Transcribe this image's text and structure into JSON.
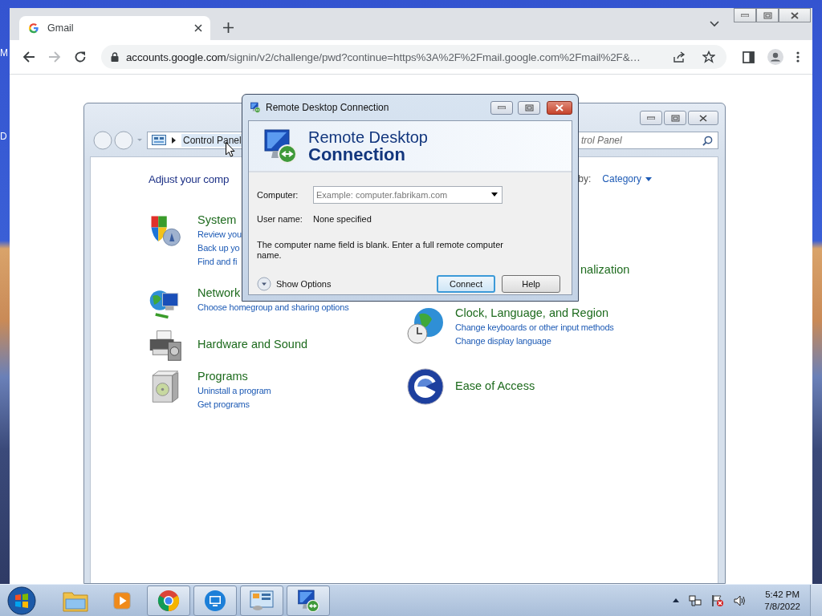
{
  "desktop": {
    "labels": [
      "M",
      "D"
    ]
  },
  "browser": {
    "tabs": [
      {
        "title": "Gmail",
        "selected": true
      }
    ],
    "forward_disabled": true,
    "url_host": "accounts.google.com",
    "url_path": "/signin/v2/challenge/pwd?continue=https%3A%2F%2Fmail.google.com%2Fmail%2F&…"
  },
  "control_panel": {
    "address": "Control Panel",
    "search_placeholder": "trol Panel",
    "heading": "Adjust your comp",
    "view_by_label": "by:",
    "view_by_value": "Category",
    "left": [
      {
        "kind": "shield",
        "title": "System",
        "links": [
          "Review you",
          "Back up yo",
          "Find and fi"
        ]
      },
      {
        "kind": "network",
        "title": "Network",
        "links": [
          "Choose homegroup and sharing options"
        ]
      },
      {
        "kind": "printer",
        "title": "Hardware and Sound"
      },
      {
        "kind": "programs",
        "title": "Programs",
        "links": [
          "Uninstall a program",
          "Get programs"
        ]
      }
    ],
    "right": [
      {
        "kind": "covered",
        "title": "nalization"
      },
      {
        "kind": "clock",
        "title": "Clock, Language, and Region",
        "links": [
          "Change keyboards or other input methods",
          "Change display language"
        ]
      },
      {
        "kind": "ease",
        "title": "Ease of Access"
      }
    ]
  },
  "dialog": {
    "title": "Remote Desktop Connection",
    "banner_line1": "Remote Desktop",
    "banner_line2": "Connection",
    "computer_label": "Computer:",
    "computer_placeholder": "Example: computer.fabrikam.com",
    "user_label": "User name:",
    "user_value": "None specified",
    "message": "The computer name field is blank. Enter a full remote computer name.",
    "show_options": "Show Options",
    "buttons": [
      {
        "label": "Connect",
        "default": true
      },
      {
        "label": "Help",
        "default": false
      }
    ]
  },
  "taskbar": {
    "apps": [
      {
        "kind": "explorer",
        "running": false
      },
      {
        "kind": "media",
        "running": false
      },
      {
        "kind": "chrome",
        "running": true
      },
      {
        "kind": "remote",
        "running": true
      },
      {
        "kind": "control",
        "running": true
      },
      {
        "kind": "rdc",
        "running": true
      }
    ],
    "time": "5:42 PM",
    "date": "7/8/2022"
  }
}
